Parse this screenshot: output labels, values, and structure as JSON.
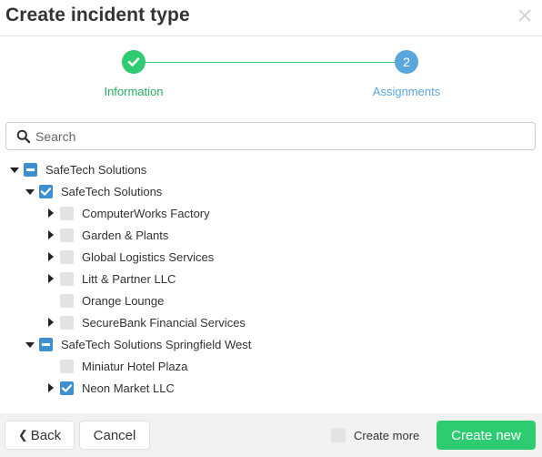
{
  "header": {
    "title": "Create incident type"
  },
  "stepper": {
    "steps": [
      {
        "label": "Information",
        "state": "complete",
        "number": ""
      },
      {
        "label": "Assignments",
        "state": "active",
        "number": "2"
      }
    ],
    "colors": {
      "complete": "#2ecc71",
      "active": "#5aa6dc"
    }
  },
  "search": {
    "placeholder": "Search",
    "value": ""
  },
  "tree": {
    "nodes": [
      {
        "label": "SafeTech Solutions",
        "level": 0,
        "expander": "expanded",
        "check": "partial"
      },
      {
        "label": "SafeTech Solutions",
        "level": 1,
        "expander": "expanded",
        "check": "checked"
      },
      {
        "label": "ComputerWorks Factory",
        "level": 2,
        "expander": "collapsed",
        "check": "unchecked"
      },
      {
        "label": "Garden & Plants",
        "level": 2,
        "expander": "collapsed",
        "check": "unchecked"
      },
      {
        "label": "Global Logistics Services",
        "level": 2,
        "expander": "collapsed",
        "check": "unchecked"
      },
      {
        "label": "Litt & Partner LLC",
        "level": 2,
        "expander": "collapsed",
        "check": "unchecked"
      },
      {
        "label": "Orange Lounge",
        "level": 2,
        "expander": "none",
        "check": "unchecked"
      },
      {
        "label": "SecureBank Financial Services",
        "level": 2,
        "expander": "collapsed",
        "check": "unchecked"
      },
      {
        "label": "SafeTech Solutions Springfield West",
        "level": 1,
        "expander": "expanded",
        "check": "partial"
      },
      {
        "label": "Miniatur Hotel Plaza",
        "level": 2,
        "expander": "none",
        "check": "unchecked"
      },
      {
        "label": "Neon Market LLC",
        "level": 2,
        "expander": "collapsed",
        "check": "checked"
      }
    ]
  },
  "footer": {
    "back_label": "Back",
    "cancel_label": "Cancel",
    "create_more_label": "Create more",
    "create_more_checked": false,
    "create_label": "Create new"
  },
  "colors": {
    "primary_green": "#2ecc71",
    "checkbox_blue": "#3d8fd0",
    "step_blue": "#5aa6dc"
  }
}
